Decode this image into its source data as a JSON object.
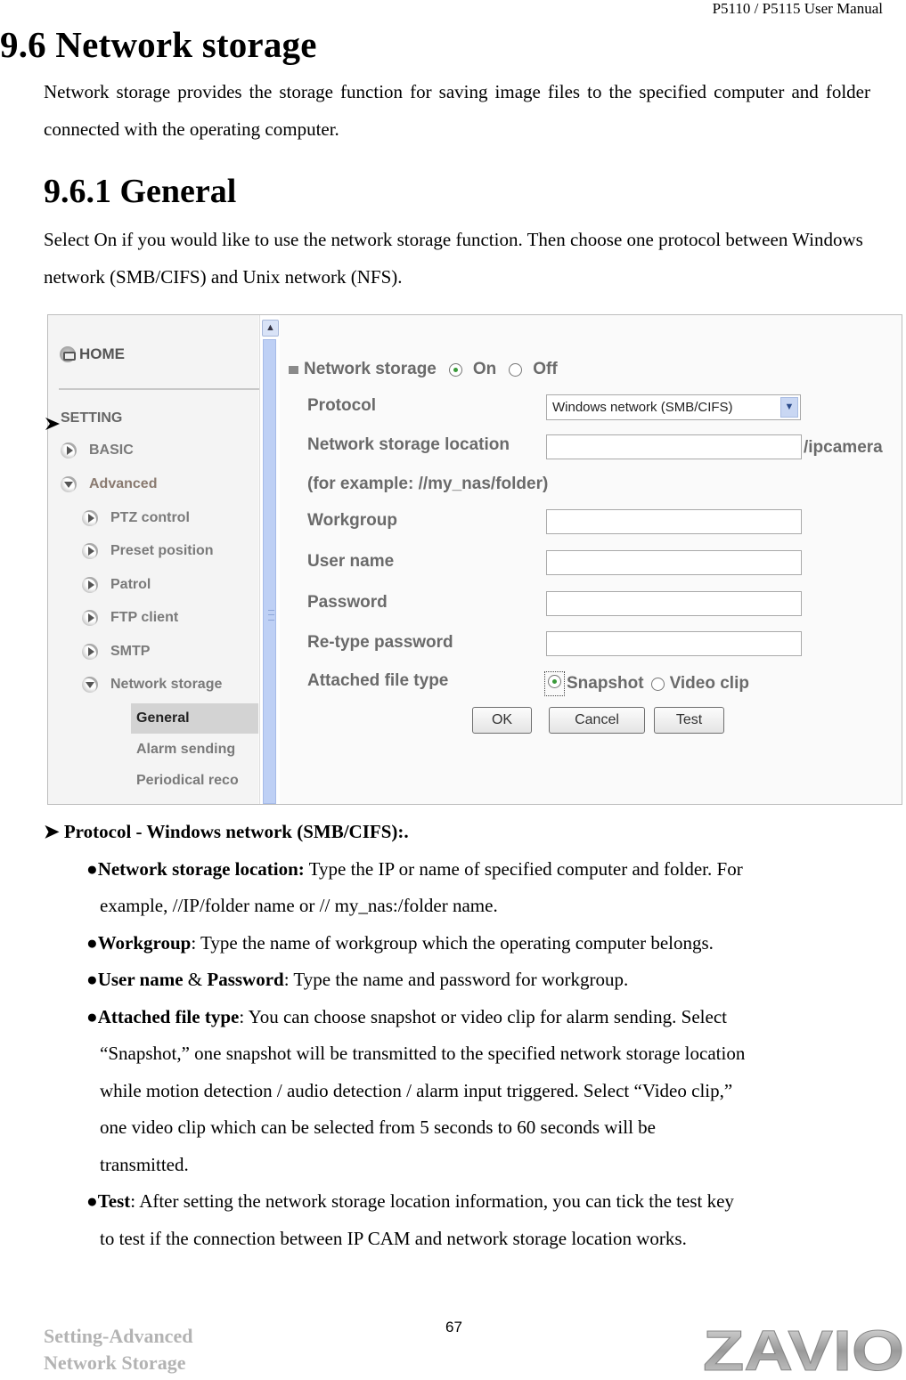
{
  "header": {
    "manual_title": "P5110 / P5115 User Manual"
  },
  "section": {
    "title": "9.6 Network storage",
    "intro": "Network storage provides the storage function for saving image files to the specified computer and folder connected with the operating computer."
  },
  "subsection": {
    "title": "9.6.1 General",
    "intro": "Select On if you would like to use the network storage function. Then choose one protocol between Windows network (SMB/CIFS) and Unix network (NFS)."
  },
  "screenshot": {
    "sidebar": {
      "home": "HOME",
      "setting": "SETTING",
      "items": [
        {
          "label": "BASIC",
          "state": "collapsed"
        },
        {
          "label": "Advanced",
          "state": "expanded"
        }
      ],
      "advanced_items": [
        {
          "label": "PTZ control",
          "state": "collapsed"
        },
        {
          "label": "Preset position",
          "state": "collapsed"
        },
        {
          "label": "Patrol",
          "state": "collapsed"
        },
        {
          "label": "FTP client",
          "state": "collapsed"
        },
        {
          "label": "SMTP",
          "state": "collapsed"
        },
        {
          "label": "Network storage",
          "state": "expanded"
        }
      ],
      "network_storage_items": [
        {
          "label": "General",
          "selected": true
        },
        {
          "label": "Alarm sending",
          "selected": false
        },
        {
          "label": "Periodical reco",
          "selected": false
        }
      ]
    },
    "form": {
      "title": "Network storage",
      "enable_options": {
        "on": "On",
        "off": "Off",
        "selected": "On"
      },
      "protocol_label": "Protocol",
      "protocol_value": "Windows network (SMB/CIFS)",
      "location_label": "Network storage location",
      "location_value": "",
      "location_suffix": "/ipcamera",
      "location_hint": "(for example: //my_nas/folder)",
      "workgroup_label": "Workgroup",
      "workgroup_value": "",
      "username_label": "User name",
      "username_value": "",
      "password_label": "Password",
      "password_value": "",
      "retype_label": "Re-type password",
      "retype_value": "",
      "filetype_label": "Attached file type",
      "filetype_options": {
        "snapshot": "Snapshot",
        "video": "Video clip",
        "selected": "Snapshot"
      },
      "buttons": {
        "ok": "OK",
        "cancel": "Cancel",
        "test": "Test"
      }
    }
  },
  "description": {
    "heading": "Protocol - Windows network (SMB/CIFS):.",
    "items": [
      {
        "term": "Network storage location:",
        "text": " Type the IP or name of specified computer and folder. For",
        "cont": [
          "example, //IP/folder name or // my_nas:/folder name."
        ]
      },
      {
        "term": "Workgroup",
        "text": ": Type the name of workgroup which the operating computer belongs.",
        "cont": []
      },
      {
        "term": "User name",
        "amp": " & ",
        "term2": "Password",
        "text": ": Type the name and password for workgroup.",
        "cont": []
      },
      {
        "term": "Attached file type",
        "text": ": You can choose snapshot or video clip for alarm sending. Select",
        "cont": [
          "“Snapshot,” one snapshot will be transmitted to the specified network storage location",
          "while motion detection / audio detection / alarm input triggered. Select “Video clip,”",
          "one video clip which can be selected from 5 seconds to 60 seconds will be",
          "transmitted."
        ]
      },
      {
        "term": "Test",
        "text": ": After setting the network storage location information, you can tick the test key",
        "cont": [
          "to test if the connection between IP CAM and network storage location works."
        ]
      }
    ]
  },
  "footer": {
    "section_line1": "Setting-Advanced",
    "section_line2": "Network Storage",
    "page_number": "67",
    "logo_text": "ZAVIO"
  }
}
